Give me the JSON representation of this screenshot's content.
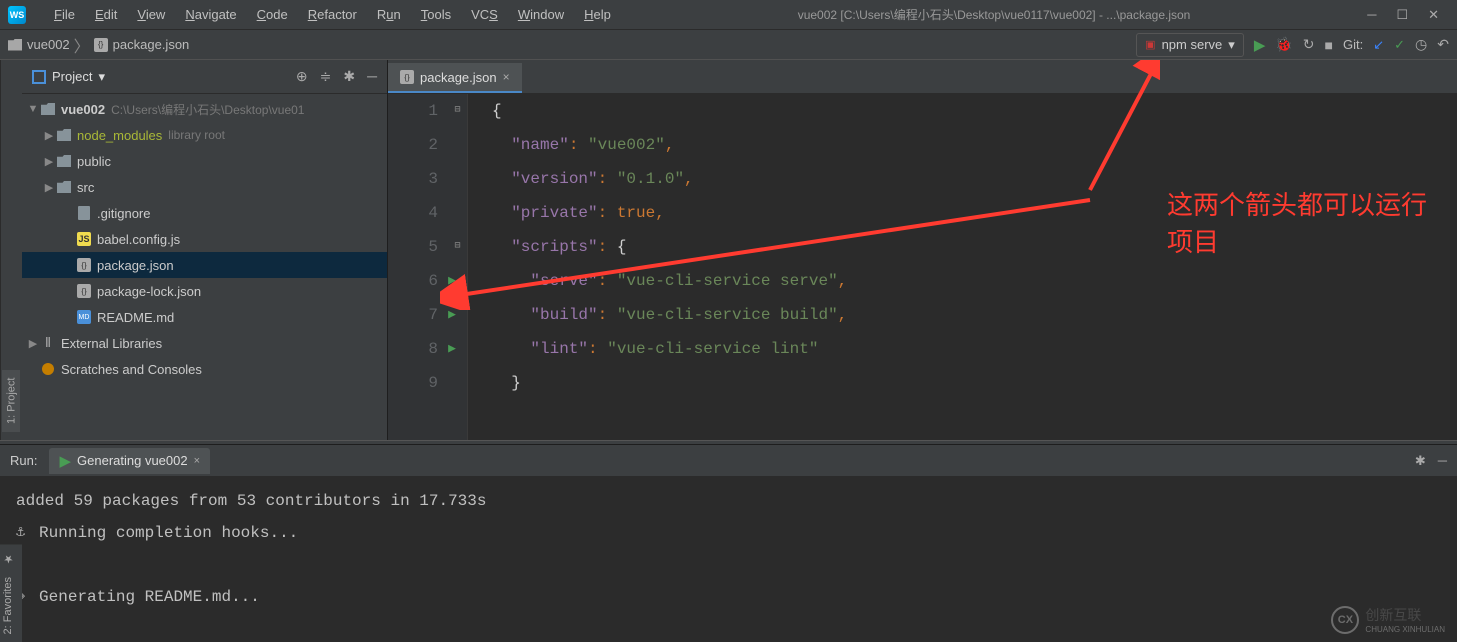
{
  "menu": {
    "items": [
      "File",
      "Edit",
      "View",
      "Navigate",
      "Code",
      "Refactor",
      "Run",
      "Tools",
      "VCS",
      "Window",
      "Help"
    ]
  },
  "window_title": "vue002 [C:\\Users\\编程小石头\\Desktop\\vue0117\\vue002] - ...\\package.json",
  "breadcrumb": {
    "root": "vue002",
    "file": "package.json"
  },
  "run_config": {
    "label": "npm serve"
  },
  "git": {
    "label": "Git:"
  },
  "project_panel": {
    "title": "Project"
  },
  "tree": {
    "root": {
      "name": "vue002",
      "path": "C:\\Users\\编程小石头\\Desktop\\vue01"
    },
    "node_modules": {
      "name": "node_modules",
      "suffix": "library root"
    },
    "public": "public",
    "src": "src",
    "gitignore": ".gitignore",
    "babel": "babel.config.js",
    "package": "package.json",
    "package_lock": "package-lock.json",
    "readme": "README.md",
    "ext_lib": "External Libraries",
    "scratch": "Scratches and Consoles"
  },
  "editor": {
    "tab": "package.json",
    "lines": [
      {
        "n": 1
      },
      {
        "n": 2
      },
      {
        "n": 3
      },
      {
        "n": 4
      },
      {
        "n": 5
      },
      {
        "n": 6,
        "play": true
      },
      {
        "n": 7,
        "play": true
      },
      {
        "n": 8,
        "play": true
      },
      {
        "n": 9
      }
    ],
    "content": {
      "name_k": "\"name\"",
      "name_v": "\"vue002\"",
      "version_k": "\"version\"",
      "version_v": "\"0.1.0\"",
      "private_k": "\"private\"",
      "private_v": "true",
      "scripts_k": "\"scripts\"",
      "serve_k": "\"serve\"",
      "serve_v": "\"vue-cli-service serve\"",
      "build_k": "\"build\"",
      "build_v": "\"vue-cli-service build\"",
      "lint_k": "\"lint\"",
      "lint_v": "\"vue-cli-service lint\""
    }
  },
  "run_panel": {
    "label": "Run:",
    "tab": "Generating vue002",
    "lines": {
      "l1": "added 59 packages from 53 contributors in 17.733s",
      "l2": "Running completion hooks...",
      "l3": "Generating README.md..."
    }
  },
  "sidebar_tabs": {
    "project": "1: Project",
    "fav": "2: Favorites"
  },
  "annotation": {
    "line1": "这两个箭头都可以运行",
    "line2": "项目"
  },
  "watermark": {
    "brand": "创新互联",
    "sub": "CHUANG XINHULIAN"
  }
}
